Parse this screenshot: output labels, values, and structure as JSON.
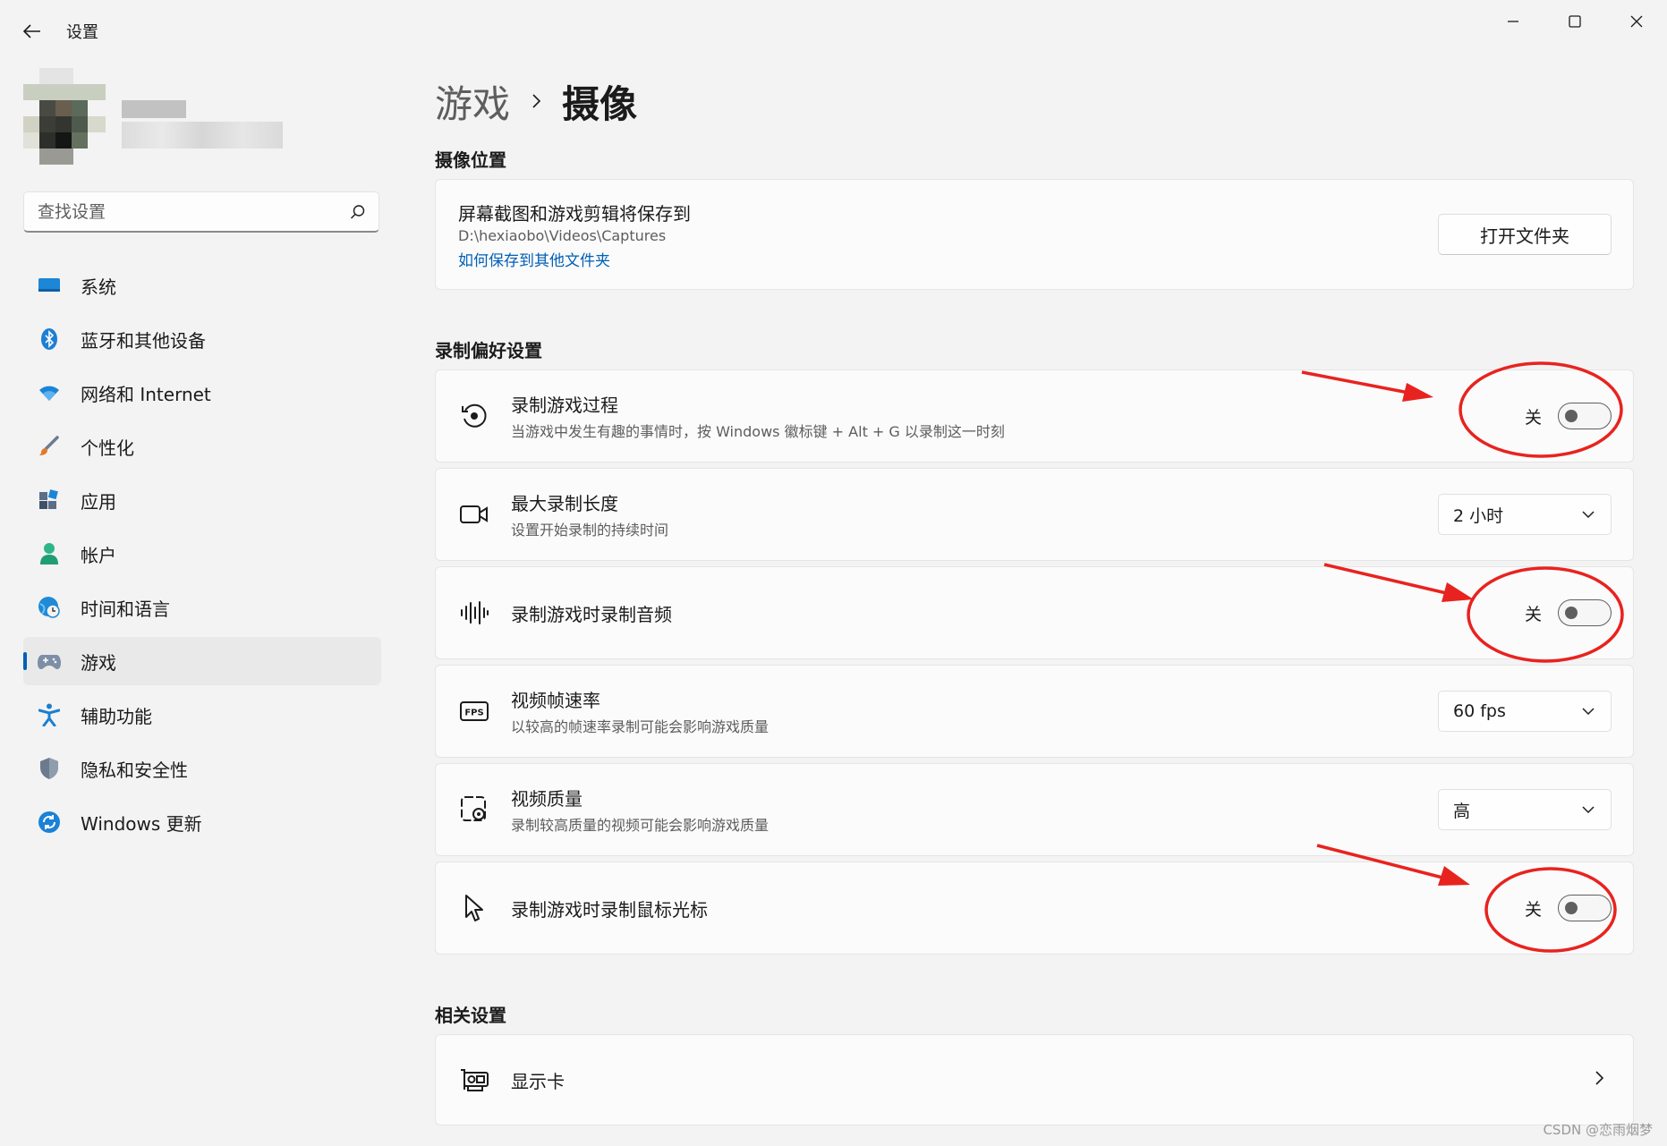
{
  "window": {
    "title": "设置",
    "back_label": "back",
    "controls": [
      "minimize",
      "maximize",
      "close"
    ]
  },
  "sidebar": {
    "search_placeholder": "查找设置",
    "items": [
      {
        "label": "系统",
        "icon": "system-icon",
        "color": "#1d86d6"
      },
      {
        "label": "蓝牙和其他设备",
        "icon": "bluetooth-icon",
        "color": "#1d7fd3"
      },
      {
        "label": "网络和 Internet",
        "icon": "wifi-icon",
        "color": "#1a84d8"
      },
      {
        "label": "个性化",
        "icon": "brush-icon",
        "color": "#e07a2c"
      },
      {
        "label": "应用",
        "icon": "apps-icon",
        "color": "#5a6e88"
      },
      {
        "label": "帐户",
        "icon": "account-icon",
        "color": "#2fb58a"
      },
      {
        "label": "时间和语言",
        "icon": "globe-clock-icon",
        "color": "#1f8ad6"
      },
      {
        "label": "游戏",
        "icon": "gamepad-icon",
        "color": "#7d8fa6",
        "active": true
      },
      {
        "label": "辅助功能",
        "icon": "accessibility-icon",
        "color": "#1b7fd1"
      },
      {
        "label": "隐私和安全性",
        "icon": "shield-icon",
        "color": "#6b7a8c"
      },
      {
        "label": "Windows 更新",
        "icon": "update-icon",
        "color": "#1a82d7"
      }
    ]
  },
  "breadcrumb": {
    "parent": "游戏",
    "current": "摄像"
  },
  "capture_location": {
    "section_title": "摄像位置",
    "title": "屏幕截图和游戏剪辑将保存到",
    "path": "D:\\hexiaobo\\Videos\\Captures",
    "link": "如何保存到其他文件夹",
    "button": "打开文件夹"
  },
  "recording": {
    "section_title": "录制偏好设置",
    "rows": [
      {
        "title": "录制游戏过程",
        "desc": "当游戏中发生有趣的事情时，按 Windows 徽标键 + Alt + G 以录制这一时刻",
        "toggle": "关",
        "icon": "record-history-icon"
      },
      {
        "title": "最大录制长度",
        "desc": "设置开始录制的持续时间",
        "dropdown": "2 小时",
        "icon": "video-camera-icon"
      },
      {
        "title": "录制游戏时录制音频",
        "desc": "",
        "toggle": "关",
        "icon": "audio-waveform-icon"
      },
      {
        "title": "视频帧速率",
        "desc": "以较高的帧速率录制可能会影响游戏质量",
        "dropdown": "60 fps",
        "icon": "fps-icon"
      },
      {
        "title": "视频质量",
        "desc": "录制较高质量的视频可能会影响游戏质量",
        "dropdown": "高",
        "icon": "video-settings-icon"
      },
      {
        "title": "录制游戏时录制鼠标光标",
        "desc": "",
        "toggle": "关",
        "icon": "cursor-icon"
      }
    ]
  },
  "related": {
    "section_title": "相关设置",
    "rows": [
      {
        "title": "显示卡",
        "icon": "graphics-card-icon"
      }
    ]
  },
  "watermark": "CSDN @恋雨烟梦",
  "annotation_color": "#e8231f"
}
